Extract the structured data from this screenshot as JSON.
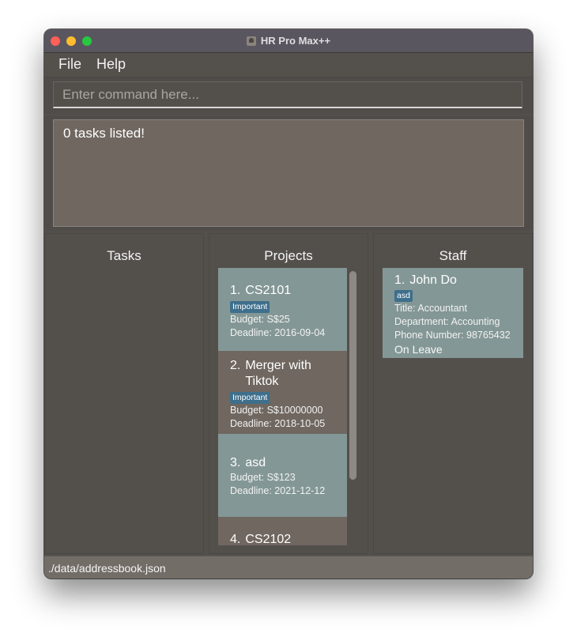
{
  "window": {
    "title": "HR Pro Max++"
  },
  "menu": {
    "file": "File",
    "help": "Help"
  },
  "command": {
    "placeholder": "Enter command here...",
    "value": ""
  },
  "result": {
    "message": "0 tasks listed!"
  },
  "panels": {
    "tasks": {
      "title": "Tasks"
    },
    "projects": {
      "title": "Projects",
      "items": [
        {
          "index": "1.",
          "name": "CS2101",
          "tag": "Important",
          "budget": "Budget: S$25",
          "deadline": "Deadline: 2016-09-04"
        },
        {
          "index": "2.",
          "name": "Merger with Tiktok",
          "tag": "Important",
          "budget": "Budget: S$10000000",
          "deadline": "Deadline: 2018-10-05"
        },
        {
          "index": "3.",
          "name": "asd",
          "budget": "Budget: S$123",
          "deadline": "Deadline: 2021-12-12"
        },
        {
          "index": "4.",
          "name": "CS2102"
        }
      ]
    },
    "staff": {
      "title": "Staff",
      "items": [
        {
          "index": "1.",
          "name": "John Do",
          "tag": "asd",
          "title": "Title: Accountant",
          "department": "Department: Accounting",
          "phone": "Phone Number: 98765432",
          "status": "On Leave"
        }
      ]
    }
  },
  "status": {
    "path": "./data/addressbook.json"
  },
  "colors": {
    "card_teal": "#839796",
    "card_brown": "#6f6760",
    "tag_blue": "#3e6f8c",
    "window_bg": "#53504c"
  },
  "icons": {
    "close": "close-light",
    "minimize": "minimize-light",
    "zoom": "zoom-light",
    "app": "app-icon"
  }
}
